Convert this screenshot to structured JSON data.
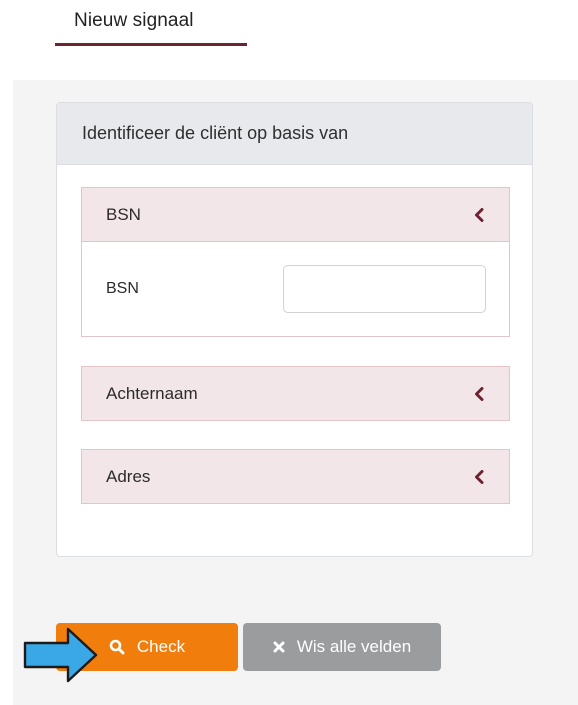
{
  "tab": {
    "title": "Nieuw signaal"
  },
  "panel": {
    "heading": "Identificeer de cliënt op basis van"
  },
  "sections": {
    "bsn": {
      "title": "BSN",
      "field_label": "BSN",
      "input_value": ""
    },
    "achternaam": {
      "title": "Achternaam"
    },
    "adres": {
      "title": "Adres"
    }
  },
  "buttons": {
    "check": {
      "label": "Check",
      "icon": "search-icon"
    },
    "clear": {
      "label": "Wis alle velden",
      "icon": "close-icon"
    }
  },
  "colors": {
    "brand_dark": "#6b2430",
    "accordion_header_bg": "#f3e6e8",
    "accordion_border": "#e3c4c9",
    "check_button": "#f07d0c",
    "clear_button": "#9a9c9e",
    "pointer_arrow": "#3aa8e6"
  }
}
